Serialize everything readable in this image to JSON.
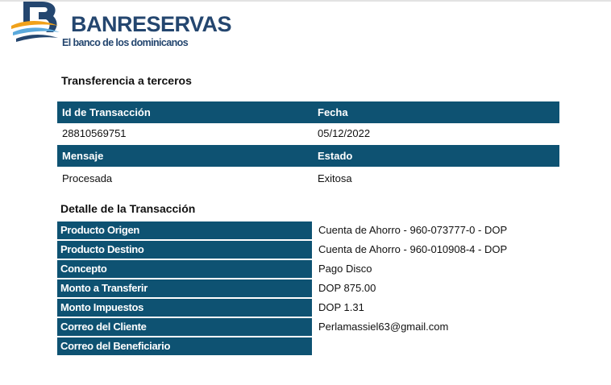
{
  "brand": {
    "name": "BANRESERVAS",
    "tagline": "El banco de los dominicanos",
    "colors": {
      "navy": "#24466f",
      "accent": "#f0a11a",
      "light_blue": "#5aa9dc",
      "table_header": "#0e5272"
    }
  },
  "summary": {
    "title": "Transferencia a terceros",
    "headers_1": [
      "Id de Transacción",
      "Fecha"
    ],
    "values_1": [
      "28810569751",
      "05/12/2022"
    ],
    "headers_2": [
      "Mensaje",
      "Estado"
    ],
    "values_2": [
      "Procesada",
      "Exitosa"
    ]
  },
  "detail": {
    "title": "Detalle de la Transacción",
    "rows": [
      {
        "label": "Producto Origen",
        "value": "Cuenta de Ahorro - 960-073777-0 - DOP"
      },
      {
        "label": "Producto Destino",
        "value": "Cuenta de Ahorro - 960-010908-4 - DOP"
      },
      {
        "label": "Concepto",
        "value": "Pago Disco"
      },
      {
        "label": "Monto a Transferir",
        "value": "DOP 875.00"
      },
      {
        "label": "Monto Impuestos",
        "value": "DOP 1.31"
      },
      {
        "label": "Correo del Cliente",
        "value": "Perlamassiel63@gmail.com"
      },
      {
        "label": "Correo del Beneficiario",
        "value": ""
      }
    ]
  }
}
